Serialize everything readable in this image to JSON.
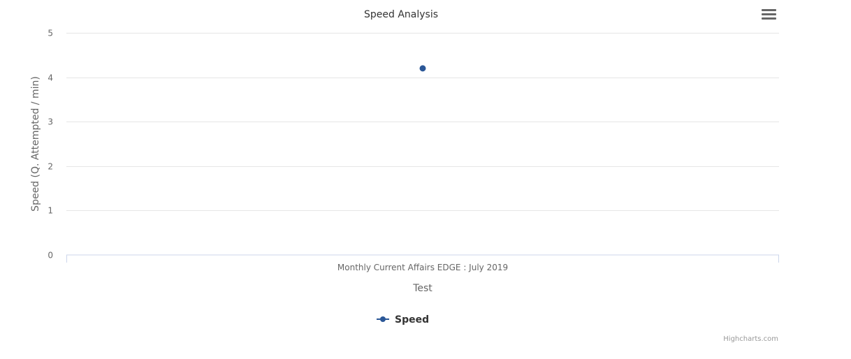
{
  "chart_data": {
    "type": "scatter",
    "title": "Speed Analysis",
    "xlabel": "Test",
    "ylabel": "Speed (Q. Attempted / min)",
    "categories": [
      "Monthly Current Affairs EDGE : July 2019"
    ],
    "ylim": [
      0,
      5
    ],
    "yticks": [
      0,
      1,
      2,
      3,
      4,
      5
    ],
    "grid": true,
    "legend_position": "bottom-center",
    "series": [
      {
        "name": "Speed",
        "values": [
          4.2
        ],
        "color": "#2b5797"
      }
    ]
  },
  "ui": {
    "menu_icon": "hamburger-icon",
    "credits": "Highcharts.com",
    "grid_color": "#e6e6e6",
    "axis_color": "#ccd6eb",
    "text_color": "#666666"
  }
}
